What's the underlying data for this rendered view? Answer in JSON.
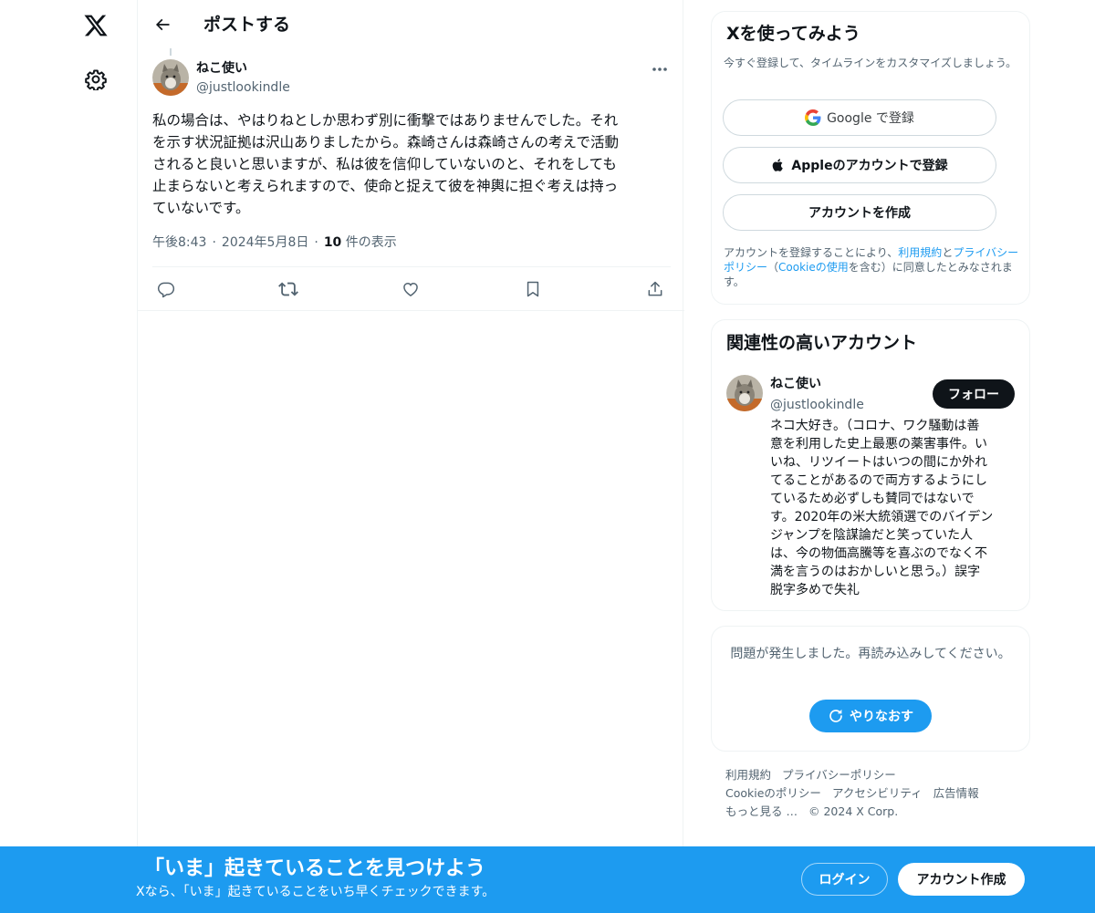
{
  "colors": {
    "accent": "#1d9bf0",
    "text_primary": "#0f1419",
    "text_secondary": "#536471",
    "border": "#eff3f4",
    "button_dark": "#0f1419"
  },
  "nav": {
    "logo_icon": "x-logo-icon",
    "settings_icon": "gear-icon"
  },
  "header": {
    "title": "ポストする",
    "back_icon": "arrow-left-icon"
  },
  "post": {
    "author_name": "ねこ使い",
    "author_handle": "@justlookindle",
    "text": "私の場合は、やはりねとしか思わず別に衝撃ではありませんでした。それ\nを示す状況証拠は沢山ありましたから。森崎さんは森崎さんの考えで活動\nされると良いと思いますが、私は彼を信仰していないのと、それをしても\n止まらないと考えられますので、使命と捉えて彼を神輿に担ぐ考えは持っ\nていないです。",
    "time": "午後8:43",
    "date": "2024年5月8日",
    "views_count": "10",
    "views_label": "件の表示",
    "actions": [
      "reply-icon",
      "repost-icon",
      "like-icon",
      "bookmark-icon",
      "share-icon"
    ]
  },
  "signup_panel": {
    "title": "Xを使ってみよう",
    "subtitle": "今すぐ登録して、タイムラインをカスタマイズしましょう。",
    "google_button": "Google で登録",
    "apple_button": "Appleのアカウントで登録",
    "create_button": "アカウントを作成",
    "terms_prefix": "アカウントを登録することにより、",
    "terms_link": "利用規約",
    "terms_and": "と",
    "privacy_link": "プライバシーポリシー",
    "terms_mid": "（",
    "cookie_link": "Cookieの使用",
    "terms_suffix": "を含む）に同意したとみなされます。"
  },
  "related_panel": {
    "title": "関連性の高いアカウント",
    "account_name": "ねこ使い",
    "account_handle": "@justlookindle",
    "follow_button": "フォロー",
    "bio": "ネコ大好き。（コロナ、ワク騒動は善\n意を利用した史上最悪の薬害事件。い\nいね、リツイートはいつの間にか外れ\nてることがあるので両方するようにし\nているため必ずしも賛同ではないで\nす。2020年の米大統領選でのバイデン\nジャンプを陰謀論だと笑っていた人\nは、今の物価高騰等を喜ぶのでなく不\n満を言うのはおかしいと思う。）誤字\n脱字多めで失礼"
  },
  "error_panel": {
    "message": "問題が発生しました。再読み込みしてください。",
    "retry_button": "やりなおす"
  },
  "footer": {
    "line1": [
      "利用規約",
      "プライバシーポリシー"
    ],
    "line2": [
      "Cookieのポリシー",
      "アクセシビリティ",
      "広告情報"
    ],
    "line3": [
      "もっと見る …",
      "© 2024 X Corp."
    ]
  },
  "bottom_bar": {
    "title": "「いま」起きていることを見つけよう",
    "subtitle": "Xなら、「いま」起きていることをいち早くチェックできます。",
    "login_button": "ログイン",
    "signup_button": "アカウント作成"
  }
}
